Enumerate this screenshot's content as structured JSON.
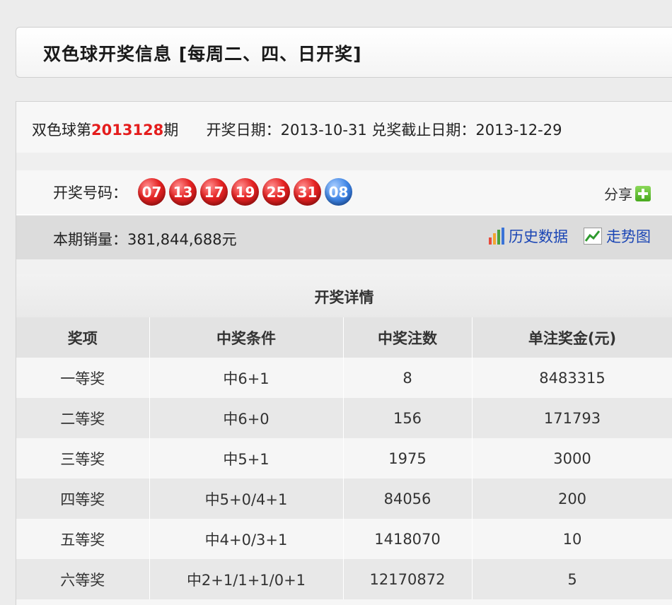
{
  "header": {
    "title": "双色球开奖信息 [每周二、四、日开奖]"
  },
  "issue": {
    "prefix": "双色球第",
    "number": "2013128",
    "suffix": "期",
    "draw_date_label": "开奖日期：",
    "draw_date": "2013-10-31",
    "deadline_label": "兑奖截止日期：",
    "deadline": "2013-12-29"
  },
  "numbers": {
    "label": "开奖号码：",
    "red": [
      "07",
      "13",
      "17",
      "19",
      "25",
      "31"
    ],
    "blue": [
      "08"
    ],
    "red_color": "#e52424",
    "blue_color": "#3f86e6"
  },
  "share": {
    "label": "分享"
  },
  "sales": {
    "label": "本期销量：",
    "value": "381,844,688元"
  },
  "links": {
    "history": "历史数据",
    "trend": "走势图"
  },
  "details": {
    "title": "开奖详情",
    "columns": [
      "奖项",
      "中奖条件",
      "中奖注数",
      "单注奖金(元)"
    ],
    "rows": [
      [
        "一等奖",
        "中6+1",
        "8",
        "8483315"
      ],
      [
        "二等奖",
        "中6+0",
        "156",
        "171793"
      ],
      [
        "三等奖",
        "中5+1",
        "1975",
        "3000"
      ],
      [
        "四等奖",
        "中5+0/4+1",
        "84056",
        "200"
      ],
      [
        "五等奖",
        "中4+0/3+1",
        "1418070",
        "10"
      ],
      [
        "六等奖",
        "中2+1/1+1/0+1",
        "12170872",
        "5"
      ]
    ]
  }
}
